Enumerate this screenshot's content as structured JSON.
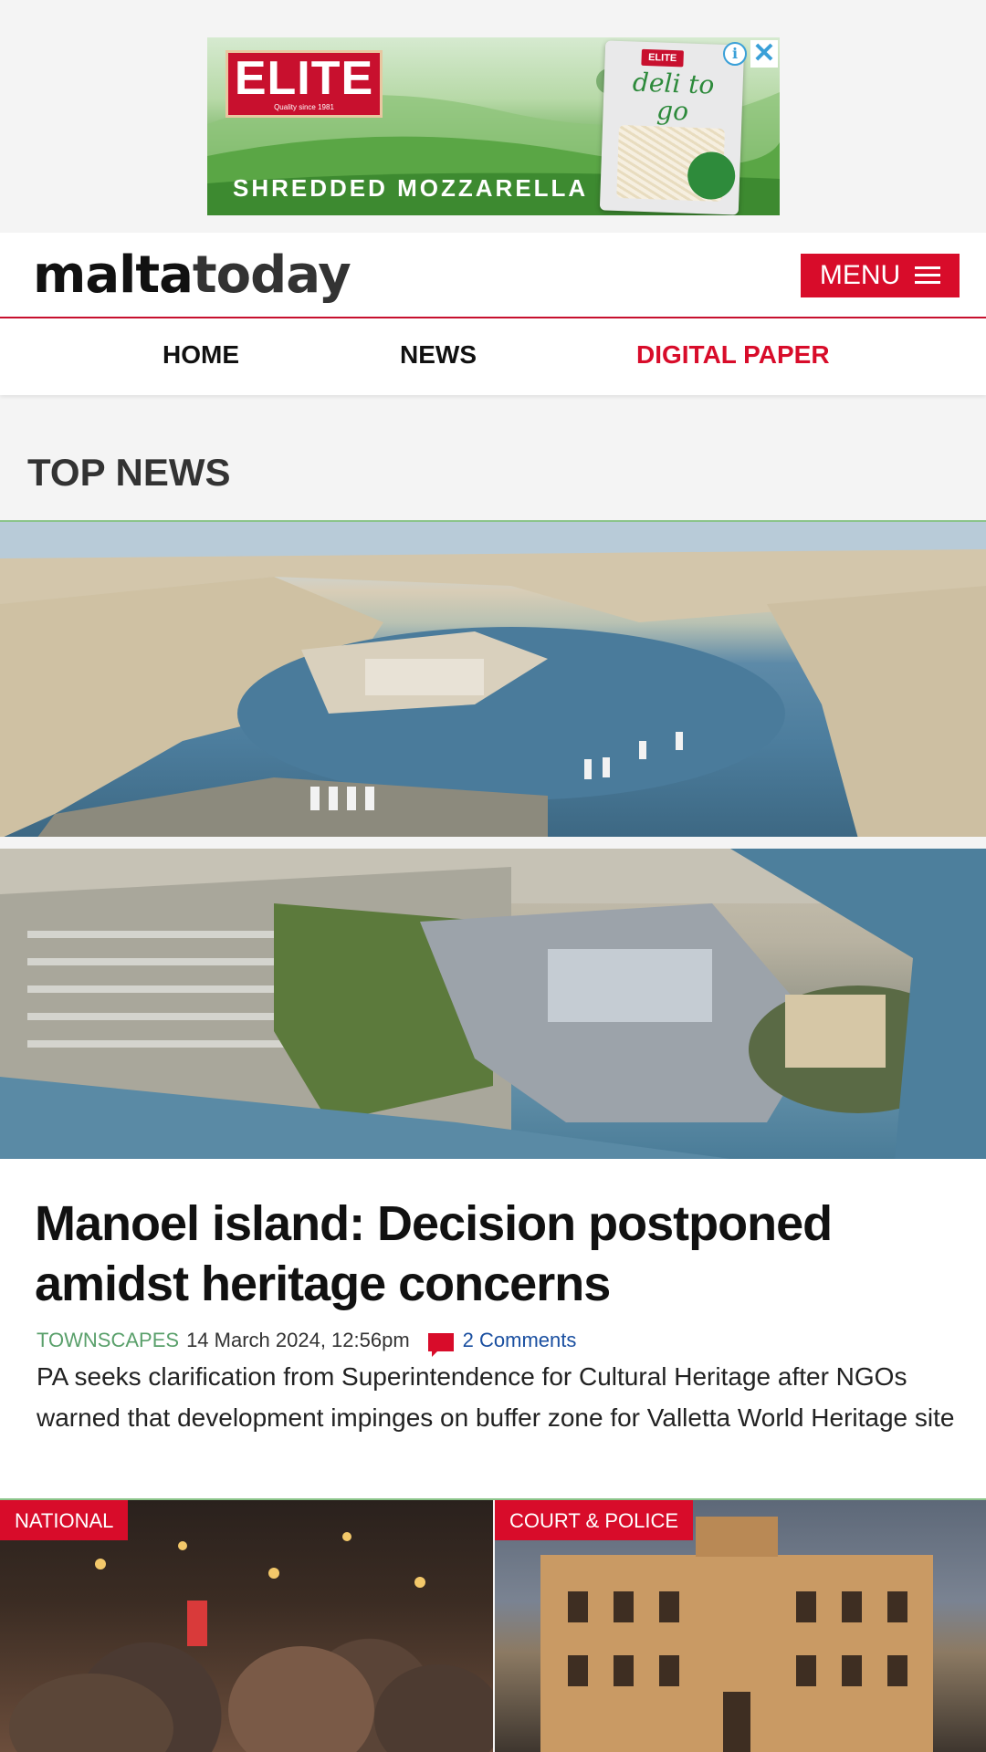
{
  "ad": {
    "brand": "ELITE",
    "brand_tagline": "Quality since 1981",
    "headline": "SHREDDED MOZZARELLA",
    "pack_brand": "ELITE",
    "pack_title": "deli to go",
    "info_icon": "info-icon",
    "close_icon": "close-icon"
  },
  "header": {
    "logo_part1": "malta",
    "logo_part2": "today",
    "menu_label": "MENU",
    "menu_icon": "hamburger-icon"
  },
  "nav": {
    "items": [
      {
        "label": "HOME"
      },
      {
        "label": "NEWS"
      },
      {
        "label": "DIGITAL PAPER"
      }
    ]
  },
  "section": {
    "title": "TOP NEWS"
  },
  "article": {
    "headline": "Manoel island: Decision postponed amidst heritage concerns",
    "category": "TOWNSCAPES",
    "date": "14 March 2024, 12:56pm",
    "comments": "2 Comments",
    "summary": "PA seeks clarification from Superintendence for Cultural Heritage after NGOs warned that development impinges on buffer zone for Valletta World Heritage site"
  },
  "cards": [
    {
      "tag": "NATIONAL"
    },
    {
      "tag": "COURT & POLICE"
    }
  ],
  "colors": {
    "accent": "#d80c2a",
    "category": "#5aa06b",
    "comment_link": "#1a4fa0"
  }
}
